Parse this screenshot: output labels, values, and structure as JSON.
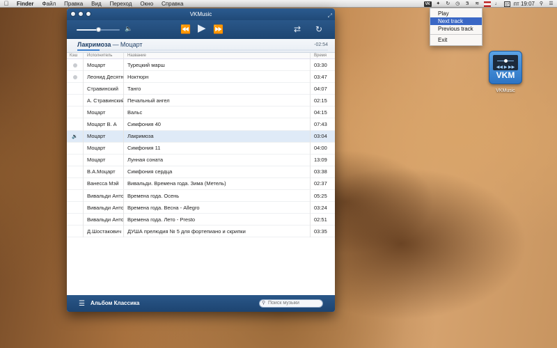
{
  "menubar": {
    "app": "Finder",
    "items": [
      "Файл",
      "Правка",
      "Вид",
      "Переход",
      "Окно",
      "Справка"
    ],
    "tray": {
      "vk_icon": "VK",
      "date_icon": "17",
      "clock": "пт 19:07"
    }
  },
  "dropdown": {
    "items": [
      {
        "label": "Play",
        "active": false
      },
      {
        "label": "Next track",
        "active": true
      },
      {
        "label": "Previous track",
        "active": false
      }
    ],
    "exit": "Exit"
  },
  "desktop_icon": {
    "caption": "VKMusic",
    "logo": "VKM"
  },
  "window": {
    "title": "VKMusic",
    "volume_level": 0.5,
    "progress_fraction": 0.09,
    "now_playing": {
      "title": "Лакримоза",
      "separator": "—",
      "artist": "Моцарт",
      "remaining": "-02:54"
    },
    "columns": {
      "cache": "Кэш",
      "artist": "Исполнитель",
      "title": "Название",
      "time": "Время"
    },
    "tracks": [
      {
        "cached": true,
        "playing": false,
        "artist": "Моцарт",
        "title": "Турецкий марш",
        "time": "03:30"
      },
      {
        "cached": true,
        "playing": false,
        "artist": "Леонид Десятников",
        "title": "Ноктюрн",
        "time": "03:47"
      },
      {
        "cached": false,
        "playing": false,
        "artist": "Стравинский",
        "title": "Танго",
        "time": "04:07"
      },
      {
        "cached": false,
        "playing": false,
        "artist": "А. Стравинский",
        "title": "Печальный ангел",
        "time": "02:15"
      },
      {
        "cached": false,
        "playing": false,
        "artist": "Моцарт",
        "title": "Вальс",
        "time": "04:15"
      },
      {
        "cached": false,
        "playing": false,
        "artist": "Моцарт В. А",
        "title": "Симфония  40",
        "time": "07:43"
      },
      {
        "cached": false,
        "playing": true,
        "artist": "Моцарт",
        "title": "Лакримоза",
        "time": "03:04"
      },
      {
        "cached": false,
        "playing": false,
        "artist": "Моцарт",
        "title": "Симфония 11",
        "time": "04:00"
      },
      {
        "cached": false,
        "playing": false,
        "artist": "Моцарт",
        "title": "Лунная соната",
        "time": "13:09"
      },
      {
        "cached": false,
        "playing": false,
        "artist": "В.А.Моцарт",
        "title": "Симфония сердца",
        "time": "03:38"
      },
      {
        "cached": false,
        "playing": false,
        "artist": "Ванесса Мэй",
        "title": "Вивальди. Времена года. Зима (Метель)",
        "time": "02:37"
      },
      {
        "cached": false,
        "playing": false,
        "artist": "Вивальди Антонио",
        "title": "Времена года. Осень",
        "time": "05:25"
      },
      {
        "cached": false,
        "playing": false,
        "artist": "Вивальди Антонио",
        "title": "Времена года. Весна - Allegro",
        "time": "03:24"
      },
      {
        "cached": false,
        "playing": false,
        "artist": "Вивальди Антонио",
        "title": "Времена года. Лето - Presto",
        "time": "02:51"
      },
      {
        "cached": false,
        "playing": false,
        "artist": "Д.Шостакович",
        "title": "ДУША прелюдия № 5 для фортепиано и скрипки",
        "time": "03:35"
      }
    ],
    "footer": {
      "album": "Альбом Классика",
      "search_placeholder": "Поиск музыки"
    }
  },
  "colors": {
    "window_chrome": "#24507f",
    "accent": "#3a67c5",
    "playing_row": "#dfeaf7"
  }
}
